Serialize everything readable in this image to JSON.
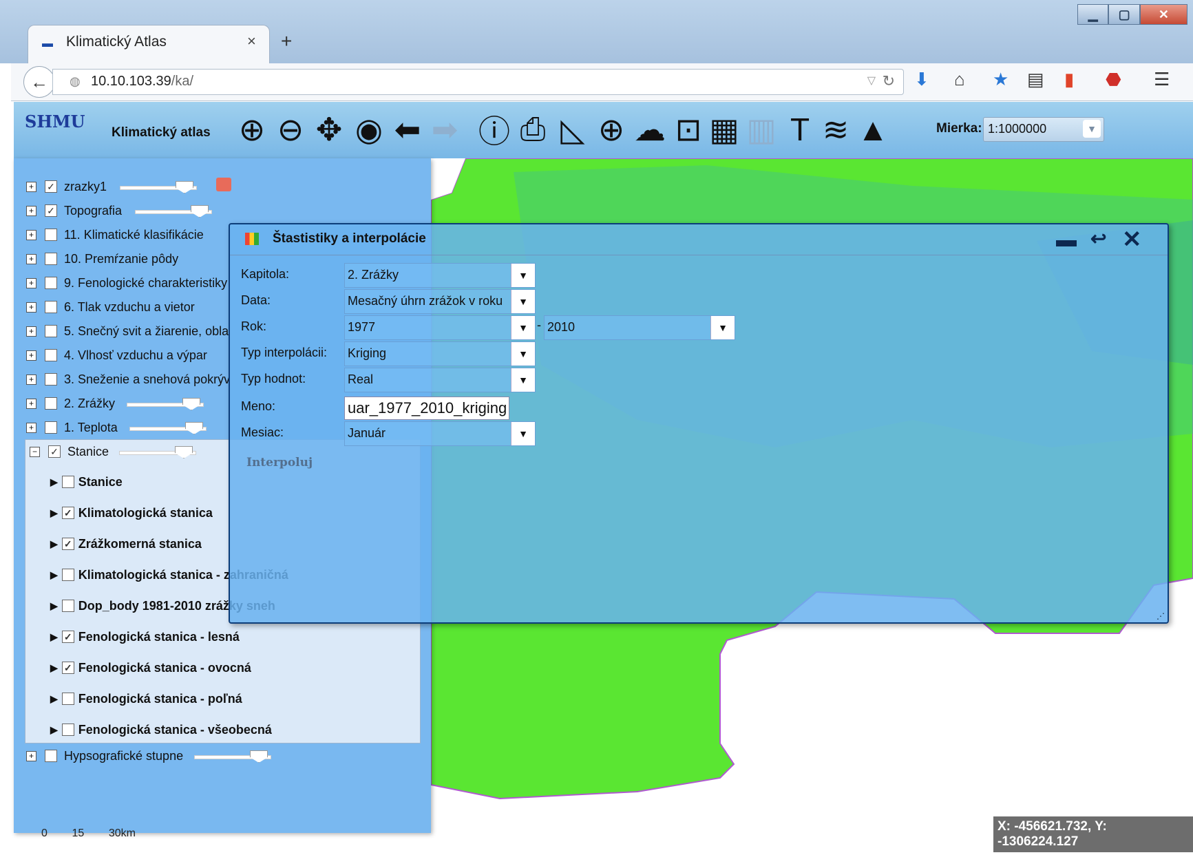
{
  "browser": {
    "tab_title": "Klimatický Atlas",
    "tab_close": "×",
    "new_tab": "+",
    "url_host": "10.10.103.39",
    "url_path": "/ka/"
  },
  "app": {
    "logo_text": "SHMU",
    "title": "Klimatický atlas",
    "scale_label": "Mierka:",
    "scale_value": "1:1000000",
    "tools": [
      "zoom-in-icon",
      "zoom-out-icon",
      "pan-icon",
      "globe-icon",
      "back-arrow-icon",
      "forward-arrow-icon",
      "info-icon",
      "print-icon",
      "measure-icon",
      "add-icon",
      "map-region-icon",
      "legend-icon",
      "table-icon",
      "chart-icon",
      "text-icon",
      "layers-icon",
      "terrain-icon"
    ]
  },
  "layers": [
    {
      "label": "zrazky1",
      "checked": true
    },
    {
      "label": "Topografia",
      "checked": true
    },
    {
      "label": "11. Klimatické klasifikácie",
      "checked": false
    },
    {
      "label": "10. Premŕzanie pôdy",
      "checked": false
    },
    {
      "label": "9. Fenologické charakteristiky",
      "checked": false
    },
    {
      "label": "6. Tlak vzduchu a vietor",
      "checked": false
    },
    {
      "label": "5. Snečný svit a žiarenie, obla",
      "checked": false
    },
    {
      "label": "4. Vlhosť vzduchu a výpar",
      "checked": false
    },
    {
      "label": "3. Sneženie a snehová pokrýv",
      "checked": false
    },
    {
      "label": "2. Zrážky",
      "checked": false
    },
    {
      "label": "1. Teplota",
      "checked": false
    },
    {
      "label": "Stanice",
      "checked": true
    },
    {
      "label": "Hypsografické stupne",
      "checked": false
    }
  ],
  "stanice": [
    {
      "label": "Stanice",
      "checked": false
    },
    {
      "label": "Klimatologická stanica",
      "checked": true
    },
    {
      "label": "Zrážkomerná stanica",
      "checked": true
    },
    {
      "label": "Klimatologická stanica - zahraničná",
      "checked": false
    },
    {
      "label": "Dop_body 1981-2010 zrážky sneh",
      "checked": false
    },
    {
      "label": "Fenologická stanica - lesná",
      "checked": true
    },
    {
      "label": "Fenologická stanica - ovocná",
      "checked": true
    },
    {
      "label": "Fenologická stanica - poľná",
      "checked": false
    },
    {
      "label": "Fenologická stanica - všeobecná",
      "checked": false
    }
  ],
  "scalebar": "0        15        30km",
  "dialog": {
    "title": "Štastistiky a interpolácie",
    "fields": {
      "kapitola_label": "Kapitola:",
      "kapitola_value": "2. Zrážky",
      "data_label": "Data:",
      "data_value": "Mesačný úhrn zrážok v roku",
      "rok_label": "Rok:",
      "rok_from": "1977",
      "rok_dash": "-",
      "rok_to": "2010",
      "typ_interp_label": "Typ interpolácii:",
      "typ_interp_value": "Kriging",
      "typ_hodnot_label": "Typ hodnot:",
      "typ_hodnot_value": "Real",
      "meno_label": "Meno:",
      "meno_value": "uar_1977_2010_kriging",
      "mesiac_label": "Mesiac:",
      "mesiac_value": "Január"
    },
    "button_label": "Interpoluj"
  },
  "map": {
    "coords": "X: -456621.732, Y: -1306224.127",
    "colors": {
      "land": "#5ae632",
      "land_dark": "#47c87a",
      "border": "#b05ad0"
    }
  }
}
